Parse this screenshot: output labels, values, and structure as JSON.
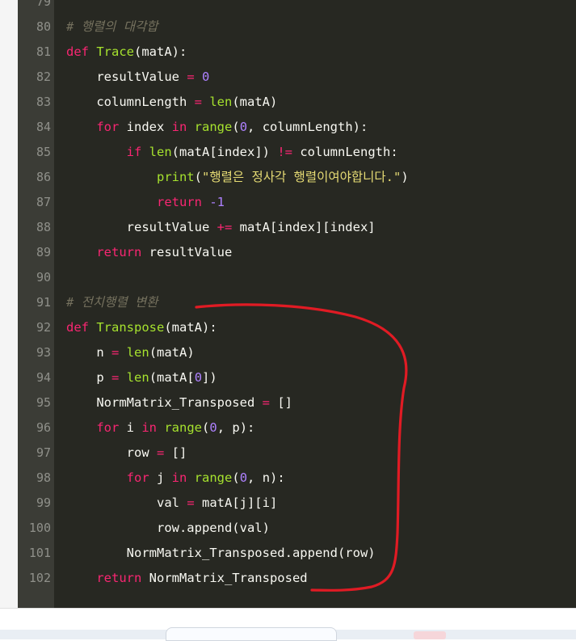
{
  "editor": {
    "lines": [
      {
        "num": "79",
        "tokens": []
      },
      {
        "num": "80",
        "tokens": [
          {
            "t": "# 행렬의 대각합",
            "c": "cmt"
          }
        ]
      },
      {
        "num": "81",
        "tokens": [
          {
            "t": "def",
            "c": "kw"
          },
          {
            "t": " "
          },
          {
            "t": "Trace",
            "c": "fn"
          },
          {
            "t": "(matA):"
          }
        ]
      },
      {
        "num": "82",
        "tokens": [
          {
            "t": "    resultValue "
          },
          {
            "t": "=",
            "c": "kw"
          },
          {
            "t": " "
          },
          {
            "t": "0",
            "c": "num"
          }
        ]
      },
      {
        "num": "83",
        "tokens": [
          {
            "t": "    columnLength "
          },
          {
            "t": "=",
            "c": "kw"
          },
          {
            "t": " "
          },
          {
            "t": "len",
            "c": "fn"
          },
          {
            "t": "(matA)"
          }
        ]
      },
      {
        "num": "84",
        "tokens": [
          {
            "t": "    "
          },
          {
            "t": "for",
            "c": "kw"
          },
          {
            "t": " index "
          },
          {
            "t": "in",
            "c": "kw"
          },
          {
            "t": " "
          },
          {
            "t": "range",
            "c": "fn"
          },
          {
            "t": "("
          },
          {
            "t": "0",
            "c": "num"
          },
          {
            "t": ", columnLength):"
          }
        ]
      },
      {
        "num": "85",
        "tokens": [
          {
            "t": "        "
          },
          {
            "t": "if",
            "c": "kw"
          },
          {
            "t": " "
          },
          {
            "t": "len",
            "c": "fn"
          },
          {
            "t": "(matA[index]) "
          },
          {
            "t": "!=",
            "c": "kw"
          },
          {
            "t": " columnLength:"
          }
        ]
      },
      {
        "num": "86",
        "tokens": [
          {
            "t": "            "
          },
          {
            "t": "print",
            "c": "fn"
          },
          {
            "t": "("
          },
          {
            "t": "\"행렬은 정사각 행렬이여야합니다.\"",
            "c": "str"
          },
          {
            "t": ")"
          }
        ]
      },
      {
        "num": "87",
        "tokens": [
          {
            "t": "            "
          },
          {
            "t": "return",
            "c": "kw"
          },
          {
            "t": " "
          },
          {
            "t": "-1",
            "c": "num"
          }
        ]
      },
      {
        "num": "88",
        "tokens": [
          {
            "t": "        resultValue "
          },
          {
            "t": "+=",
            "c": "kw"
          },
          {
            "t": " matA[index][index]"
          }
        ]
      },
      {
        "num": "89",
        "tokens": [
          {
            "t": "    "
          },
          {
            "t": "return",
            "c": "kw"
          },
          {
            "t": " resultValue"
          }
        ]
      },
      {
        "num": "90",
        "tokens": []
      },
      {
        "num": "91",
        "tokens": [
          {
            "t": "# 전치행렬 변환",
            "c": "cmt"
          }
        ]
      },
      {
        "num": "92",
        "tokens": [
          {
            "t": "def",
            "c": "kw"
          },
          {
            "t": " "
          },
          {
            "t": "Transpose",
            "c": "fn"
          },
          {
            "t": "(matA):"
          }
        ]
      },
      {
        "num": "93",
        "tokens": [
          {
            "t": "    n "
          },
          {
            "t": "=",
            "c": "kw"
          },
          {
            "t": " "
          },
          {
            "t": "len",
            "c": "fn"
          },
          {
            "t": "(matA)"
          }
        ]
      },
      {
        "num": "94",
        "tokens": [
          {
            "t": "    p "
          },
          {
            "t": "=",
            "c": "kw"
          },
          {
            "t": " "
          },
          {
            "t": "len",
            "c": "fn"
          },
          {
            "t": "(matA["
          },
          {
            "t": "0",
            "c": "num"
          },
          {
            "t": "])"
          }
        ]
      },
      {
        "num": "95",
        "tokens": [
          {
            "t": "    NormMatrix_Transposed "
          },
          {
            "t": "=",
            "c": "kw"
          },
          {
            "t": " []"
          }
        ]
      },
      {
        "num": "96",
        "tokens": [
          {
            "t": "    "
          },
          {
            "t": "for",
            "c": "kw"
          },
          {
            "t": " i "
          },
          {
            "t": "in",
            "c": "kw"
          },
          {
            "t": " "
          },
          {
            "t": "range",
            "c": "fn"
          },
          {
            "t": "("
          },
          {
            "t": "0",
            "c": "num"
          },
          {
            "t": ", p):"
          }
        ]
      },
      {
        "num": "97",
        "tokens": [
          {
            "t": "        row "
          },
          {
            "t": "=",
            "c": "kw"
          },
          {
            "t": " []"
          }
        ]
      },
      {
        "num": "98",
        "tokens": [
          {
            "t": "        "
          },
          {
            "t": "for",
            "c": "kw"
          },
          {
            "t": " j "
          },
          {
            "t": "in",
            "c": "kw"
          },
          {
            "t": " "
          },
          {
            "t": "range",
            "c": "fn"
          },
          {
            "t": "("
          },
          {
            "t": "0",
            "c": "num"
          },
          {
            "t": ", n):"
          }
        ]
      },
      {
        "num": "99",
        "tokens": [
          {
            "t": "            val "
          },
          {
            "t": "=",
            "c": "kw"
          },
          {
            "t": " matA[j][i]"
          }
        ]
      },
      {
        "num": "100",
        "tokens": [
          {
            "t": "            row.append(val)"
          }
        ]
      },
      {
        "num": "101",
        "tokens": [
          {
            "t": "        NormMatrix_Transposed.append(row)"
          }
        ]
      },
      {
        "num": "102",
        "tokens": [
          {
            "t": "    "
          },
          {
            "t": "return",
            "c": "kw"
          },
          {
            "t": " NormMatrix_Transposed"
          }
        ]
      }
    ]
  },
  "colors": {
    "background": "#272822",
    "gutter": "#3b3c36",
    "line_number": "#8f908a",
    "keyword": "#f92672",
    "function": "#a6e22e",
    "number": "#ae81ff",
    "string": "#e6db74",
    "comment": "#75715e",
    "annotation": "#e01b24"
  }
}
